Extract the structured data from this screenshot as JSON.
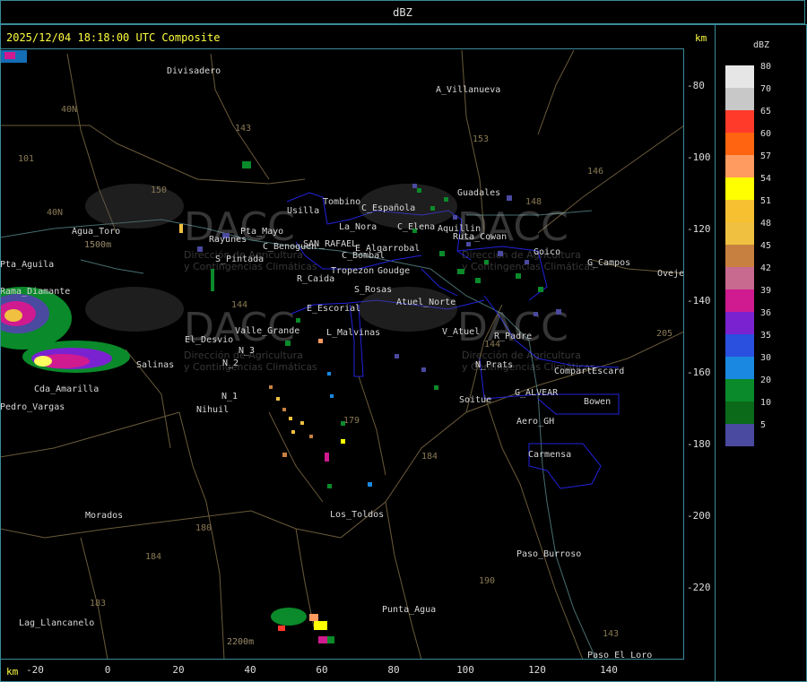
{
  "header": {
    "title": "dBZ"
  },
  "timestamp": "2025/12/04 18:18:00 UTC Composite",
  "axis": {
    "unit_top": "km",
    "unit_bottom": "km",
    "y_ticks": [
      "-80",
      "-100",
      "-120",
      "-140",
      "-160",
      "-180",
      "-200",
      "-220"
    ],
    "x_ticks": [
      "-20",
      "0",
      "20",
      "40",
      "60",
      "80",
      "100",
      "120",
      "140"
    ]
  },
  "legend": {
    "unit": "dBZ",
    "entries": [
      {
        "value": "80",
        "color": "#e6e6e6"
      },
      {
        "value": "70",
        "color": "#c8c8c8"
      },
      {
        "value": "65",
        "color": "#ff3a2a"
      },
      {
        "value": "60",
        "color": "#ff6410"
      },
      {
        "value": "57",
        "color": "#ff9a60"
      },
      {
        "value": "54",
        "color": "#ffff00"
      },
      {
        "value": "51",
        "color": "#f7c030"
      },
      {
        "value": "48",
        "color": "#f0c040"
      },
      {
        "value": "45",
        "color": "#c88040"
      },
      {
        "value": "42",
        "color": "#c86a90"
      },
      {
        "value": "39",
        "color": "#d01a90"
      },
      {
        "value": "36",
        "color": "#7a22d0"
      },
      {
        "value": "35",
        "color": "#2a50e0"
      },
      {
        "value": "30",
        "color": "#1a88e0"
      },
      {
        "value": "20",
        "color": "#0a8a2a"
      },
      {
        "value": "10",
        "color": "#0a6a1a"
      },
      {
        "value": "5",
        "color": "#4a4aa0"
      }
    ]
  },
  "watermark": {
    "brand": "DACC",
    "line1": "Dirección de Agricultura",
    "line2": "y Contingencias Climáticas"
  },
  "places": [
    "Divisadero",
    "A_Villanueva",
    "Guadales",
    "Usilla",
    "Tombino",
    "C_Española",
    "La_Nora",
    "C_Elena",
    "Aquillin",
    "Ruta_Cowan",
    "Goico",
    "G_Campos",
    "Ovejeria",
    "Agua_Toro",
    "Rama_Diamante",
    "Rayunes",
    "Pta_Mayo",
    "S_Pintada",
    "C_Benoguen",
    "SAN_RAFAEL",
    "E_Algarrobal",
    "C_Bombal",
    "Tropezon",
    "Goudge",
    "R_Caida",
    "S_Rosas",
    "Atuel_Norte",
    "E_Escorial",
    "Valle_Grande",
    "El_Desvio",
    "L_Malvinas",
    "V_Atuel",
    "R_Padre",
    "N_Prats",
    "CompartEscard",
    "G_ALVEAR",
    "Bowen",
    "Soitue",
    "Aero_GH",
    "Carmensa",
    "Salinas",
    "Cda_Amarilla",
    "Pedro_Vargas",
    "Nihuil",
    "N_2",
    "N_1",
    "N_3",
    "Los_Toldos",
    "Morados",
    "Paso_Burroso",
    "Punta_Agua",
    "Lag_Llancanelo",
    "Paso_El_Loro",
    "Pta_Aguila"
  ],
  "routes": [
    "143",
    "153",
    "146",
    "150",
    "40N",
    "40N",
    "101",
    "144",
    "179",
    "184",
    "180",
    "184",
    "183",
    "190",
    "143",
    "205",
    "148",
    "144"
  ],
  "elevations": [
    "1500m",
    "2200m"
  ]
}
